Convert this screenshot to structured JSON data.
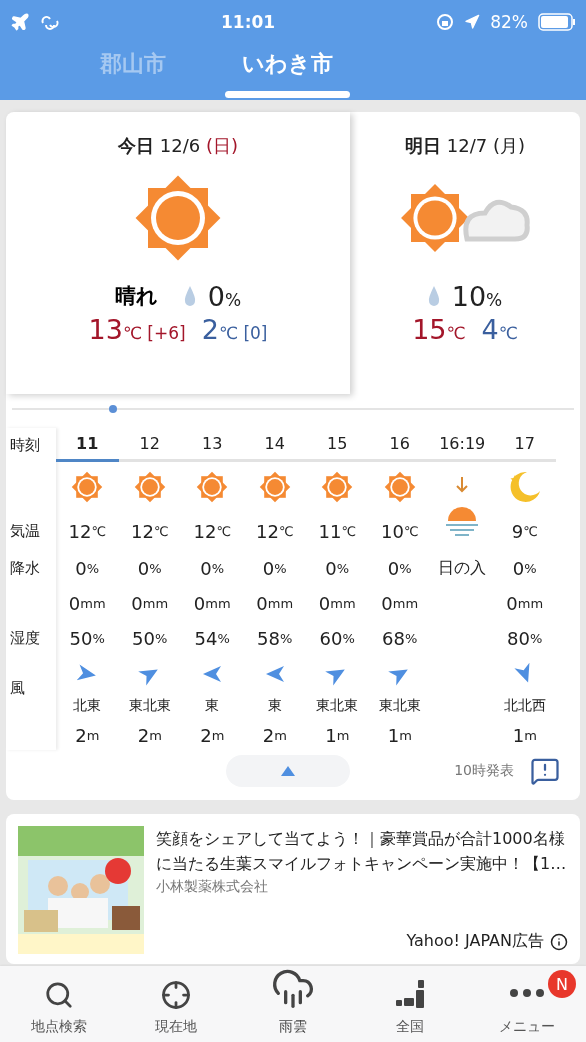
{
  "status_bar": {
    "time": "11:01",
    "battery_text": "82%"
  },
  "city_tabs": [
    {
      "label": "郡山市",
      "selected": false
    },
    {
      "label": "いわき市",
      "selected": true
    }
  ],
  "days": [
    {
      "kind": "sun",
      "label": "今日",
      "date": "12/6",
      "weekday": "(日)",
      "holiday": true,
      "selected": true,
      "weather": "晴れ",
      "precip": "0",
      "precip_unit": "%",
      "high": "13",
      "high_unit": "℃",
      "high_diff": "[+6]",
      "low": "2",
      "low_unit": "℃",
      "low_diff": "[0]"
    },
    {
      "kind": "sun_cloud",
      "label": "明日",
      "date": "12/7",
      "weekday": "(月)",
      "holiday": false,
      "selected": false,
      "precip": "10",
      "precip_unit": "%",
      "high": "15",
      "high_unit": "℃",
      "low": "4",
      "low_unit": "℃"
    }
  ],
  "hourly": {
    "row_labels": {
      "time": "時刻",
      "temp": "気温",
      "precip": "降水",
      "humidity": "湿度",
      "wind": "風"
    },
    "columns": [
      {
        "kind": "sun",
        "time": "11",
        "selected": true,
        "temp": "12",
        "temp_unit": "℃",
        "precip": "0",
        "precip_unit": "%",
        "rain": "0",
        "rain_unit": "mm",
        "humidity": "50",
        "humidity_unit": "%",
        "wind_dir": "北東",
        "wind_speed": "2",
        "wind_unit": "m"
      },
      {
        "kind": "sun",
        "time": "12",
        "selected": false,
        "temp": "12",
        "temp_unit": "℃",
        "precip": "0",
        "precip_unit": "%",
        "rain": "0",
        "rain_unit": "mm",
        "humidity": "50",
        "humidity_unit": "%",
        "wind_dir": "東北東",
        "wind_speed": "2",
        "wind_unit": "m"
      },
      {
        "kind": "sun",
        "time": "13",
        "selected": false,
        "temp": "12",
        "temp_unit": "℃",
        "precip": "0",
        "precip_unit": "%",
        "rain": "0",
        "rain_unit": "mm",
        "humidity": "54",
        "humidity_unit": "%",
        "wind_dir": "東",
        "wind_speed": "2",
        "wind_unit": "m"
      },
      {
        "kind": "sun",
        "time": "14",
        "selected": false,
        "temp": "12",
        "temp_unit": "℃",
        "precip": "0",
        "precip_unit": "%",
        "rain": "0",
        "rain_unit": "mm",
        "humidity": "58",
        "humidity_unit": "%",
        "wind_dir": "東",
        "wind_speed": "2",
        "wind_unit": "m"
      },
      {
        "kind": "sun",
        "time": "15",
        "selected": false,
        "temp": "11",
        "temp_unit": "℃",
        "precip": "0",
        "precip_unit": "%",
        "rain": "0",
        "rain_unit": "mm",
        "humidity": "60",
        "humidity_unit": "%",
        "wind_dir": "東北東",
        "wind_speed": "1",
        "wind_unit": "m"
      },
      {
        "kind": "sun",
        "time": "16",
        "selected": false,
        "temp": "10",
        "temp_unit": "℃",
        "precip": "0",
        "precip_unit": "%",
        "rain": "0",
        "rain_unit": "mm",
        "humidity": "68",
        "humidity_unit": "%",
        "wind_dir": "東北東",
        "wind_speed": "1",
        "wind_unit": "m"
      },
      {
        "kind": "sunset",
        "time": "16:19",
        "label": "日の入"
      },
      {
        "kind": "moon",
        "time": "17",
        "selected": false,
        "temp": "9",
        "temp_unit": "℃",
        "precip": "0",
        "precip_unit": "%",
        "rain": "0",
        "rain_unit": "mm",
        "humidity": "80",
        "humidity_unit": "%",
        "wind_dir": "北北西",
        "wind_speed": "1",
        "wind_unit": "m"
      }
    ],
    "issued": "10時発表"
  },
  "ad": {
    "kind": "picture",
    "title": "笑顔をシェアして当てよう！｜豪華賞品が合計1000名様に当たる生葉スマイルフォトキャンペーン実施中！【1…",
    "sponsor": "小林製薬株式会社",
    "label": "Yahoo! JAPAN広告"
  },
  "bottom_nav": [
    {
      "kind": "search",
      "label": "地点検索",
      "selected": false
    },
    {
      "kind": "location",
      "label": "現在地",
      "selected": false
    },
    {
      "kind": "rain",
      "label": "雨雲",
      "selected": true
    },
    {
      "kind": "country",
      "label": "全国",
      "selected": false
    },
    {
      "kind": "menu",
      "label": "メニュー",
      "selected": false,
      "badge": "N"
    }
  ]
}
